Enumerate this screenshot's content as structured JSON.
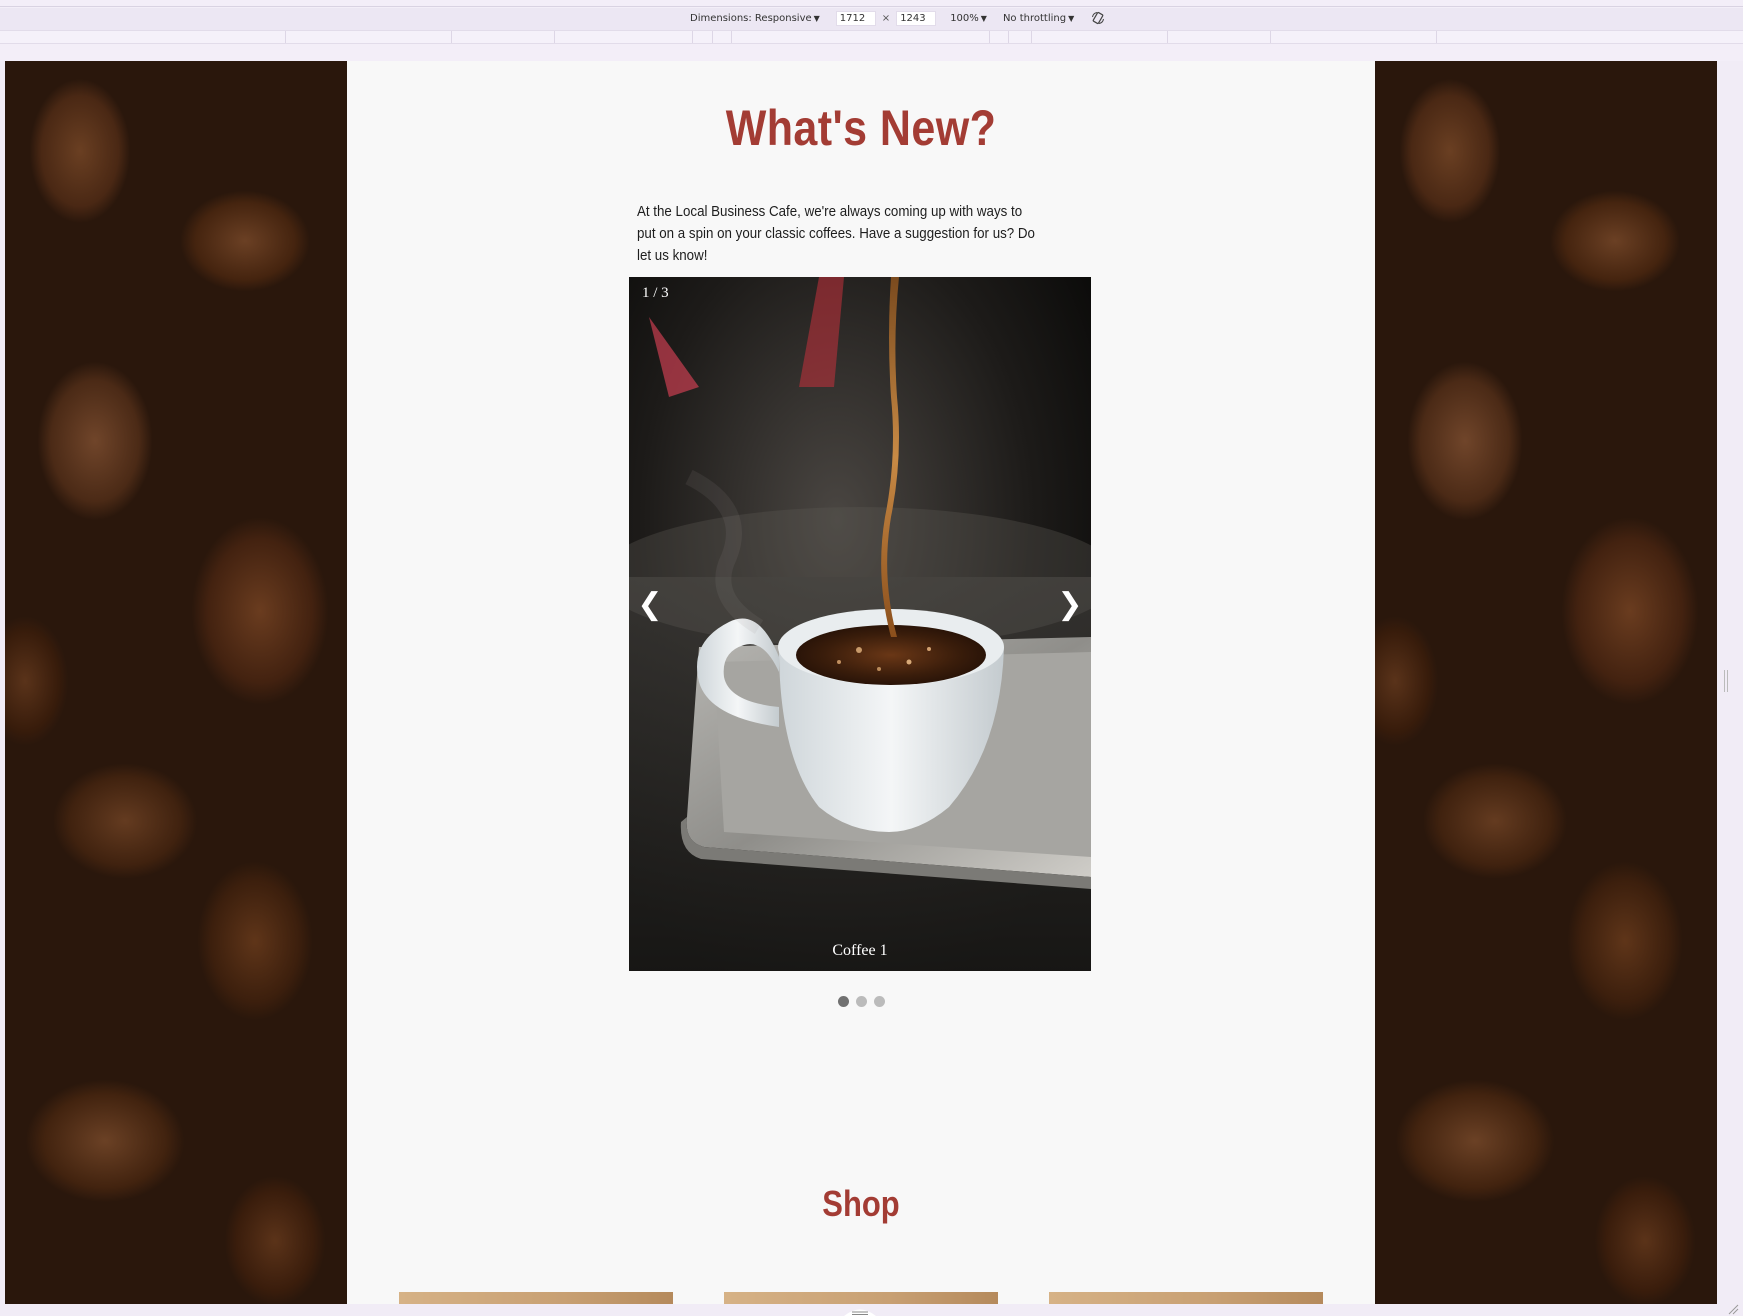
{
  "devtools": {
    "dimensions_label": "Dimensions: Responsive",
    "width": "1712",
    "times": "×",
    "height": "1243",
    "zoom": "100%",
    "throttling": "No throttling",
    "rotate_icon": "rotate-icon"
  },
  "page": {
    "title": "What's New?",
    "intro": "At the Local Business Cafe, we're always coming up with ways to put on a spin on your classic coffees. Have a suggestion for us? Do let us know!",
    "carousel": {
      "counter": "1 / 3",
      "caption": "Coffee 1",
      "prev": "❮",
      "next": "❯",
      "dots": 3,
      "active_index": 0
    },
    "shop_title": "Shop"
  },
  "colors": {
    "heading": "#a33c34",
    "dot_active": "#717171",
    "dot_inactive": "#bbbbbb"
  }
}
